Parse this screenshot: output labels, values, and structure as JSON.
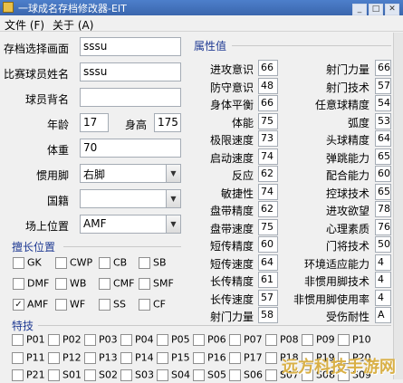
{
  "window": {
    "title": "一球成名存档修改器-EIT"
  },
  "menu": [
    {
      "label": "文件 (F)"
    },
    {
      "label": "关于 (A)"
    }
  ],
  "form": {
    "save_screen_label": "存档选择画面",
    "save_screen_value": "sssu",
    "player_name_label": "比赛球员姓名",
    "player_name_value": "sssu",
    "back_name_label": "球员背名",
    "back_name_value": "",
    "age_label": "年龄",
    "age_value": "17",
    "height_label": "身高",
    "height_value": "175",
    "weight_label": "体重",
    "weight_value": "70",
    "foot_label": "惯用脚",
    "foot_value": "右脚",
    "nationality_label": "国籍",
    "nationality_value": "",
    "position_label": "场上位置",
    "position_value": "AMF"
  },
  "positions": {
    "title": "擅长位置",
    "items": [
      {
        "label": "GK",
        "checked": false
      },
      {
        "label": "CWP",
        "checked": false
      },
      {
        "label": "CB",
        "checked": false
      },
      {
        "label": "SB",
        "checked": false
      },
      {
        "label": "DMF",
        "checked": false
      },
      {
        "label": "WB",
        "checked": false
      },
      {
        "label": "CMF",
        "checked": false
      },
      {
        "label": "SMF",
        "checked": false
      },
      {
        "label": "AMF",
        "checked": true
      },
      {
        "label": "WF",
        "checked": false
      },
      {
        "label": "SS",
        "checked": false
      },
      {
        "label": "CF",
        "checked": false
      }
    ]
  },
  "attributes": {
    "title": "属性值",
    "left": [
      {
        "label": "进攻意识",
        "value": "66"
      },
      {
        "label": "防守意识",
        "value": "48"
      },
      {
        "label": "身体平衡",
        "value": "66"
      },
      {
        "label": "体能",
        "value": "75"
      },
      {
        "label": "极限速度",
        "value": "73"
      },
      {
        "label": "启动速度",
        "value": "74"
      },
      {
        "label": "反应",
        "value": "62"
      },
      {
        "label": "敏捷性",
        "value": "74"
      },
      {
        "label": "盘带精度",
        "value": "62"
      },
      {
        "label": "盘带速度",
        "value": "75"
      },
      {
        "label": "短传精度",
        "value": "60"
      },
      {
        "label": "短传速度",
        "value": "64"
      },
      {
        "label": "长传精度",
        "value": "61"
      },
      {
        "label": "长传速度",
        "value": "57"
      },
      {
        "label": "射门力量",
        "value": "58"
      }
    ],
    "right": [
      {
        "label": "射门力量",
        "value": "66"
      },
      {
        "label": "射门技术",
        "value": "57"
      },
      {
        "label": "任意球精度",
        "value": "54"
      },
      {
        "label": "弧度",
        "value": "53"
      },
      {
        "label": "头球精度",
        "value": "64"
      },
      {
        "label": "弹跳能力",
        "value": "65"
      },
      {
        "label": "配合能力",
        "value": "60"
      },
      {
        "label": "控球技术",
        "value": "65"
      },
      {
        "label": "进攻欲望",
        "value": "78"
      },
      {
        "label": "心理素质",
        "value": "76"
      },
      {
        "label": "门将技术",
        "value": "50"
      },
      {
        "label": "环境适应能力",
        "value": "4"
      },
      {
        "label": "非惯用脚技术",
        "value": "4"
      },
      {
        "label": "非惯用脚使用率",
        "value": "4"
      },
      {
        "label": "受伤耐性",
        "value": "A"
      }
    ]
  },
  "skills": {
    "title": "特技",
    "row1": [
      "P01",
      "P02",
      "P03",
      "P04",
      "P05",
      "P06",
      "P07",
      "P08",
      "P09",
      "P10"
    ],
    "row2": [
      "P11",
      "P12",
      "P13",
      "P14",
      "P15",
      "P16",
      "P17",
      "P18",
      "P19",
      "P20"
    ],
    "row3": [
      "P21",
      "S01",
      "S02",
      "S03",
      "S04",
      "S05",
      "S06",
      "S07",
      "S08",
      "S09"
    ]
  },
  "watermark": "远方科技手游网"
}
